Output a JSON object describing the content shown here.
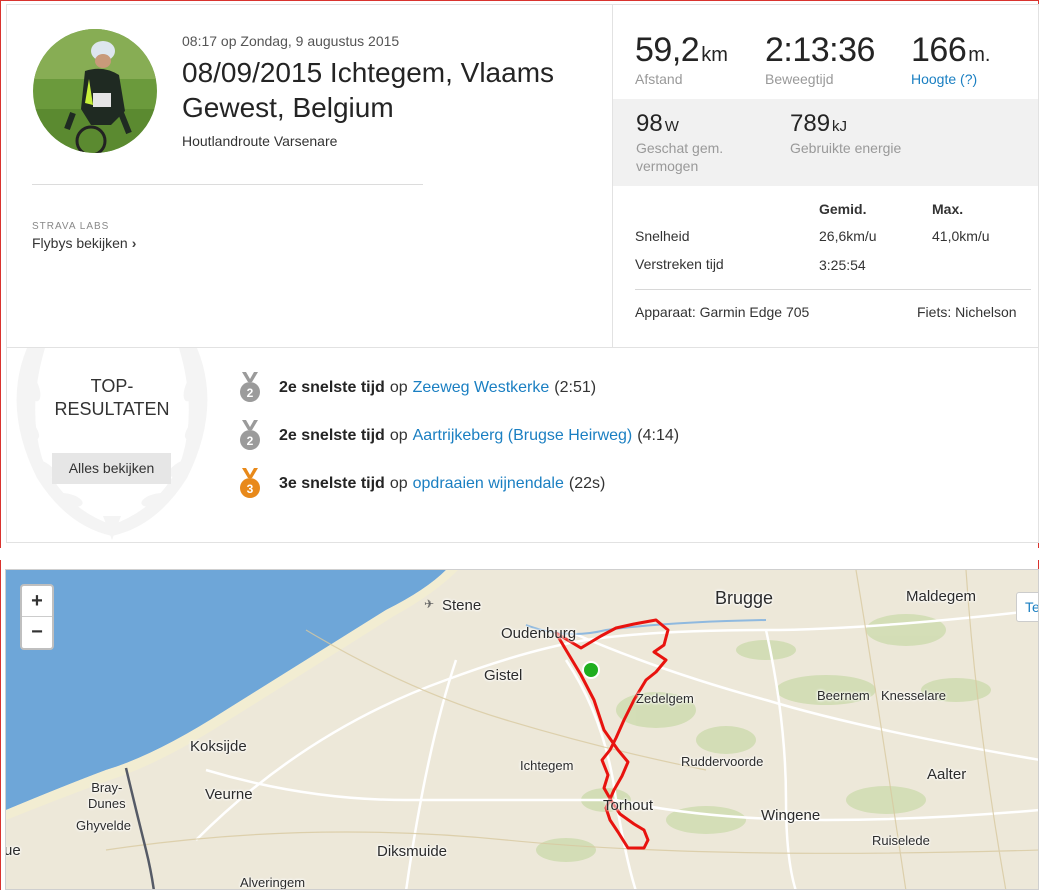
{
  "activity": {
    "datetime": "08:17 op Zondag, 9 augustus 2015",
    "title": "08/09/2015 Ichtegem, Vlaams Gewest, Belgium",
    "description": "Houtlandroute Varsenare"
  },
  "labs": {
    "label": "STRAVA LABS",
    "flyby_link": "Flybys bekijken",
    "chevron": "›"
  },
  "stats": {
    "distance": {
      "value": "59,2",
      "unit": "km",
      "label": "Afstand"
    },
    "moving_time": {
      "value": "2:13:36",
      "label": "Beweegtijd"
    },
    "elevation": {
      "value": "166",
      "unit": "m.",
      "label": "Hoogte (?)"
    },
    "power": {
      "value": "98",
      "unit": "W",
      "label": "Geschat gem. vermogen"
    },
    "energy": {
      "value": "789",
      "unit": "kJ",
      "label": "Gebruikte energie"
    }
  },
  "speed_table": {
    "col_avg": "Gemid.",
    "col_max": "Max.",
    "rows": [
      {
        "label": "Snelheid",
        "avg": "26,6km/u",
        "max": "41,0km/u"
      },
      {
        "label": "Verstreken tijd",
        "avg": "3:25:54",
        "max": ""
      }
    ]
  },
  "device": "Apparaat: Garmin Edge 705",
  "bike": "Fiets: Nichelson",
  "top_results": {
    "title_line1": "TOP-",
    "title_line2": "RESULTATEN",
    "see_all": "Alles bekijken",
    "items": [
      {
        "rank": "2",
        "medal": "silver",
        "time_label": "2e snelste tijd",
        "op": "op",
        "segment": "Zeeweg Westkerke",
        "time": "(2:51)"
      },
      {
        "rank": "2",
        "medal": "silver",
        "time_label": "2e snelste tijd",
        "op": "op",
        "segment": "Aartrijkeberg (Brugse Heirweg)",
        "time": "(4:14)"
      },
      {
        "rank": "3",
        "medal": "bronze",
        "time_label": "3e snelste tijd",
        "op": "op",
        "segment": "opdraaien wijnendale",
        "time": "(22s)"
      }
    ]
  },
  "map": {
    "zoom_in": "+",
    "zoom_out": "−",
    "corner_control": "Te",
    "places": {
      "stene": "Stene",
      "brugge": "Brugge",
      "maldegem": "Maldegem",
      "oudenburg": "Oudenburg",
      "gistel": "Gistel",
      "zedelgem": "Zedelgem",
      "beernem": "Beernem",
      "knesselare": "Knesselare",
      "koksijde": "Koksijde",
      "ichtegem": "Ichtegem",
      "ruddervoorde": "Ruddervoorde",
      "aalter": "Aalter",
      "bray_dunes": "Bray-\nDunes",
      "veurne": "Veurne",
      "torhout": "Torhout",
      "ghyvelde": "Ghyvelde",
      "wingene": "Wingene",
      "ruiselede": "Ruiselede",
      "ue": "ue",
      "diksmuide": "Diksmuide",
      "alveringem": "Alveringem"
    },
    "colors": {
      "route": "#e8130f",
      "start_marker": "#1fae1f",
      "sea": "#6ea6d8",
      "land": "#ede8d9"
    }
  },
  "colors": {
    "link": "#1a7fc2",
    "silver_medal": "#9b9b9b",
    "bronze_medal": "#e8891a"
  }
}
